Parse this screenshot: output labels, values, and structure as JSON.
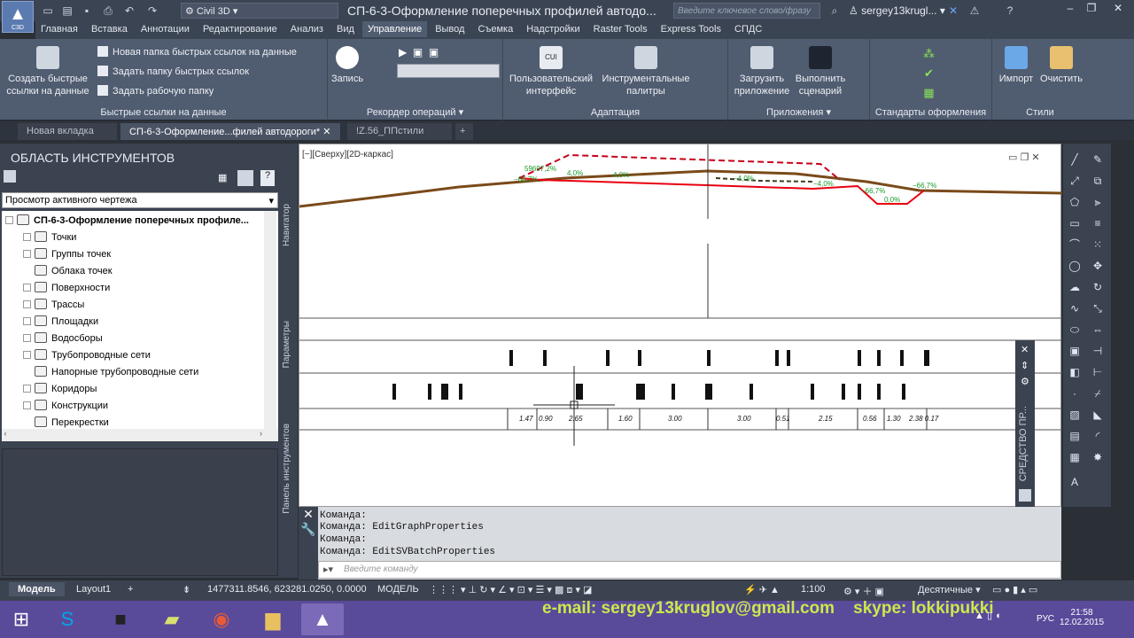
{
  "app": {
    "logo_label": "C3D",
    "workspace": "Civil 3D",
    "title": "СП-6-3-Оформление поперечных профилей автодо...",
    "search_placeholder": "Введите ключевое слово/фразу",
    "user": "sergey13krugl..."
  },
  "menu_tabs": [
    "Главная",
    "Вставка",
    "Аннотации",
    "Редактирование",
    "Анализ",
    "Вид",
    "Управление",
    "Вывод",
    "Съемка",
    "Надстройки",
    "Raster Tools",
    "Express Tools",
    "СПДС"
  ],
  "active_tab": "Управление",
  "ribbon": {
    "quicklinks": {
      "title": "Быстрые ссылки на данные",
      "create": "Создать быстрые ссылки на данные",
      "new_folder": "Новая папка быстрых ссылок на данные",
      "set_folder": "Задать папку быстрых ссылок",
      "set_work": "Задать рабочую папку"
    },
    "recorder": {
      "title": "Рекордер операций",
      "record": "Запись"
    },
    "adapt": {
      "title": "Адаптация",
      "ui": "Пользовательский интерфейс",
      "palettes": "Инструментальные палитры",
      "cui": "CUI"
    },
    "apps": {
      "title": "Приложения",
      "load": "Загрузить приложение",
      "run": "Выполнить сценарий"
    },
    "standards": {
      "title": "Стандарты оформления"
    },
    "styles": {
      "title": "Стили",
      "import": "Импорт",
      "clear": "Очистить"
    }
  },
  "doc_tabs": [
    "Новая вкладка",
    "СП-6-3-Оформление...филей автодороги*",
    "!Z.56_ППстили"
  ],
  "toolspace": {
    "header": "ОБЛАСТЬ ИНСТРУМЕНТОВ",
    "view": "Просмотр активного чертежа",
    "root": "СП-6-3-Оформление поперечных профиле...",
    "items": [
      "Точки",
      "Группы точек",
      "Облака точек",
      "Поверхности",
      "Трассы",
      "Площадки",
      "Водосборы",
      "Трубопроводные сети",
      "Напорные трубопроводные сети",
      "Коридоры",
      "Конструкции",
      "Перекрестки"
    ]
  },
  "vtabs": [
    "Навигатор",
    "Параметры",
    "Панель инструментов"
  ],
  "viewport_label": "[−][Сверху][2D-каркас]",
  "profile_labels": [
    "59697,2%",
    "−66,7%",
    "4,0%",
    "4,0%",
    "−4,0%",
    "−4,0%",
    "−66,7%",
    "0,0%",
    "−66,7%"
  ],
  "distances": [
    "1.47",
    "0.90",
    "2.65",
    "1.60",
    "3.00",
    "3.00",
    "0.51",
    "2.15",
    "0.56",
    "1.30",
    "2.38 0.17"
  ],
  "commands": [
    "Команда:",
    "Команда: EditGraphProperties",
    "Команда:",
    "Команда: EditSVBatchProperties"
  ],
  "command_placeholder": "Введите команду",
  "side_palette": "СРЕДСТВО ПР...",
  "status": {
    "model_tab": "Модель",
    "layout_tab": "Layout1",
    "coords": "1477311.8546, 623281.0250, 0.0000",
    "mode": "МОДЕЛЬ",
    "scale": "1:100",
    "units": "Десятичные"
  },
  "overlay": {
    "email": "e-mail: sergey13kruglov@gmail.com",
    "skype": "skype: lokkipukki"
  },
  "clock": {
    "time": "21:58",
    "date": "12.02.2015",
    "lang": "РУС"
  }
}
